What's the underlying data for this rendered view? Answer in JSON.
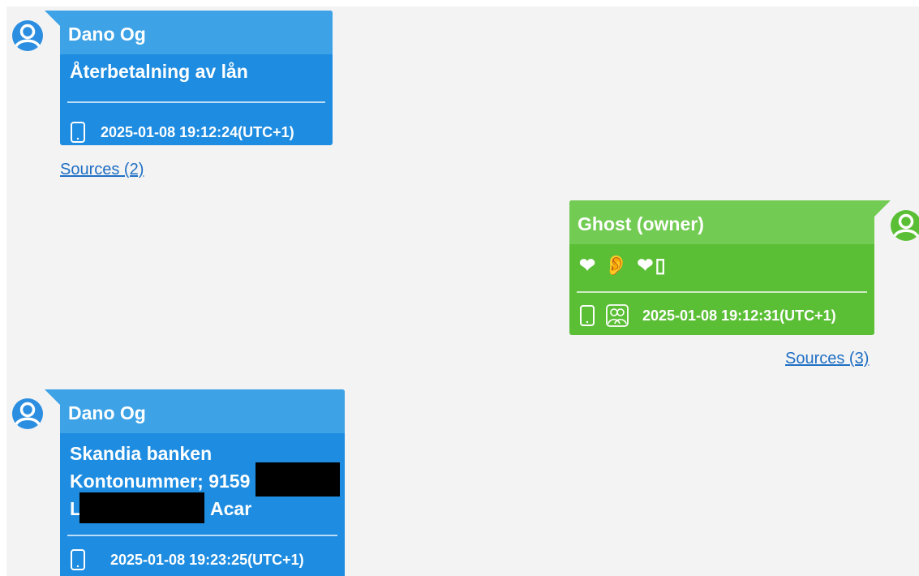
{
  "messages": [
    {
      "sender": "Dano Og",
      "body_lines": [
        "Återbetalning av lån"
      ],
      "timestamp": "2025-01-08 19:12:24(UTC+1)",
      "sources_label": "Sources (2)",
      "direction": "incoming"
    },
    {
      "sender": "Ghost (owner)",
      "body_emoji": "❤ 👂 ❤▯",
      "timestamp": "2025-01-08 19:12:31(UTC+1)",
      "sources_label": "Sources (3)",
      "direction": "outgoing"
    },
    {
      "sender": "Dano Og",
      "body_lines": [
        "Skandia banken",
        "Kontonummer; 9159",
        "L",
        "Acar"
      ],
      "timestamp": "2025-01-08 19:23:25(UTC+1)",
      "direction": "incoming"
    }
  ],
  "icons": {
    "avatar": "user-avatar-icon",
    "device": "phone-icon",
    "group": "group-icon"
  },
  "colors": {
    "incoming_bubble": "#1e8ce0",
    "incoming_header": "#3da2e6",
    "outgoing_bubble": "#5bbf36",
    "outgoing_header": "#72cb52",
    "link": "#1f6fc4",
    "redaction": "#000000"
  }
}
